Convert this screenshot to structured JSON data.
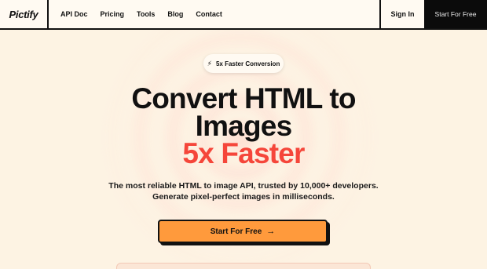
{
  "brand": {
    "logo": "Pictify"
  },
  "nav": {
    "links": [
      "API Doc",
      "Pricing",
      "Tools",
      "Blog",
      "Contact"
    ],
    "signin": "Sign In",
    "start": "Start For Free"
  },
  "hero": {
    "badge": "5x Faster Conversion",
    "badge_icon": "⚡",
    "line1": "Convert HTML to",
    "line2": "Images",
    "line3": "5x Faster",
    "sub1": "The most reliable HTML to image API, trusted by 10,000+ developers.",
    "sub2": "Generate pixel-perfect images in milliseconds.",
    "cta": "Start For Free",
    "cta_icon": "→"
  },
  "colors": {
    "accent": "#f5463a",
    "cta": "#ff9a3c",
    "background": "#fdf3e3"
  }
}
